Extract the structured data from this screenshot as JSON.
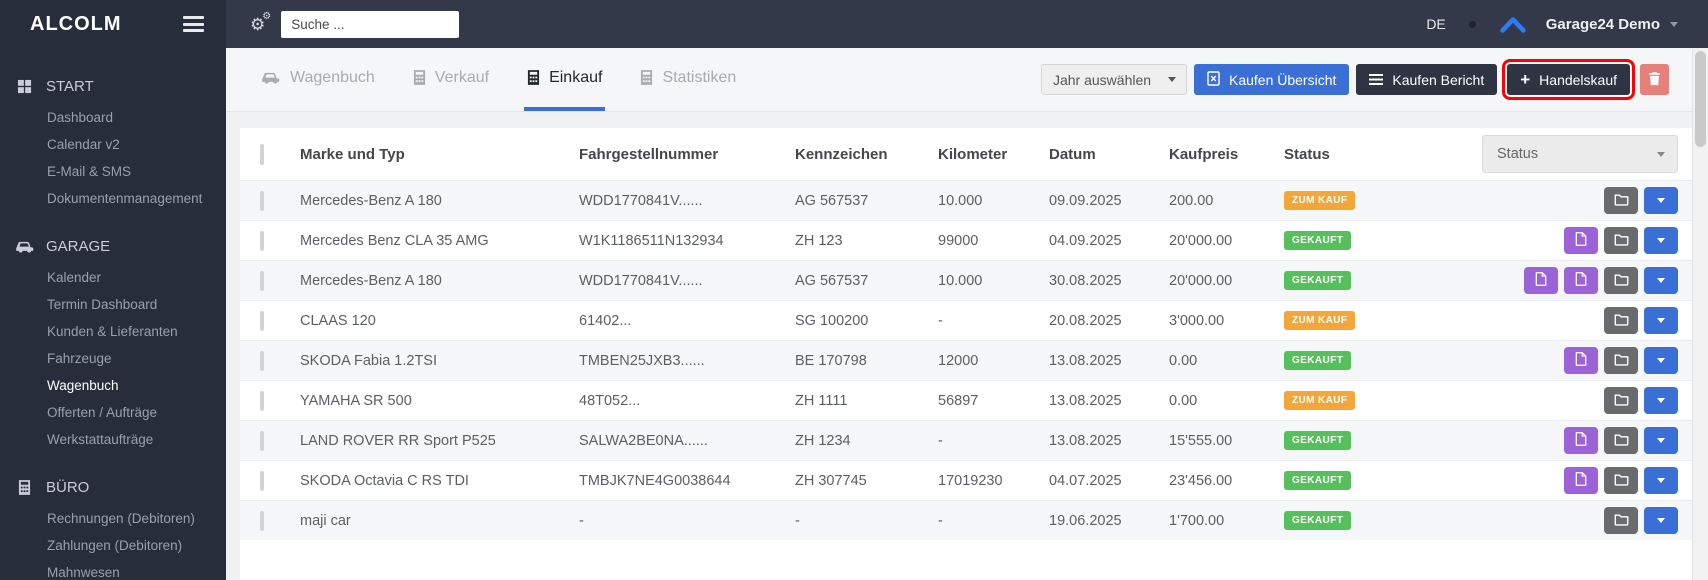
{
  "app": {
    "brand": "ALCOLM"
  },
  "topbar": {
    "search_placeholder": "Suche ...",
    "language": "DE",
    "account_name": "Garage24 Demo"
  },
  "sidebar": {
    "sections": [
      {
        "label": "START",
        "icon": "grid",
        "items": [
          "Dashboard",
          "Calendar v2",
          "E-Mail & SMS",
          "Dokumentenmanagement"
        ]
      },
      {
        "label": "GARAGE",
        "icon": "car",
        "active": "Wagenbuch",
        "items": [
          "Kalender",
          "Termin Dashboard",
          "Kunden & Lieferanten",
          "Fahrzeuge",
          "Wagenbuch",
          "Offerten / Aufträge",
          "Werkstattaufträge"
        ]
      },
      {
        "label": "BÜRO",
        "icon": "calculator",
        "items": [
          "Rechnungen (Debitoren)",
          "Zahlungen (Debitoren)",
          "Mahnwesen"
        ]
      }
    ]
  },
  "tabs": [
    {
      "label": "Wagenbuch",
      "icon": "car",
      "active": false
    },
    {
      "label": "Verkauf",
      "icon": "calculator",
      "active": false
    },
    {
      "label": "Einkauf",
      "icon": "calculator",
      "active": true
    },
    {
      "label": "Statistiken",
      "icon": "calculator",
      "active": false
    }
  ],
  "toolbar": {
    "year_select_label": "Jahr auswählen",
    "buy_overview_label": "Kaufen Übersicht",
    "buy_report_label": "Kaufen Bericht",
    "trade_purchase_label": "Handelskauf"
  },
  "table": {
    "columns": [
      "Marke und Typ",
      "Fahrgestellnummer",
      "Kennzeichen",
      "Kilometer",
      "Datum",
      "Kaufpreis",
      "Status"
    ],
    "status_filter_label": "Status",
    "status_colors": {
      "ZUM KAUF": "#f3a73a",
      "GEKAUFT": "#57bf5b"
    },
    "rows": [
      {
        "make": "Mercedes-Benz A 180",
        "vin": "WDD1770841V......",
        "plate": "AG 567537",
        "km": "10.000",
        "date": "09.09.2025",
        "price": "200.00",
        "status": "ZUM KAUF",
        "actions": [
          "folder",
          "dropdown"
        ]
      },
      {
        "make": "Mercedes Benz CLA 35 AMG",
        "vin": "W1K1186511N132934",
        "plate": "ZH 123",
        "km": "99000",
        "date": "04.09.2025",
        "price": "20'000.00",
        "status": "GEKAUFT",
        "actions": [
          "pdf",
          "folder",
          "dropdown"
        ]
      },
      {
        "make": "Mercedes-Benz A 180",
        "vin": "WDD1770841V......",
        "plate": "AG 567537",
        "km": "10.000",
        "date": "30.08.2025",
        "price": "20'000.00",
        "status": "GEKAUFT",
        "actions": [
          "pdf",
          "pdf",
          "folder",
          "dropdown"
        ]
      },
      {
        "make": "CLAAS 120",
        "vin": "61402...",
        "plate": "SG 100200",
        "km": "-",
        "date": "20.08.2025",
        "price": "3'000.00",
        "status": "ZUM KAUF",
        "actions": [
          "folder",
          "dropdown"
        ]
      },
      {
        "make": "SKODA Fabia 1.2TSI",
        "vin": "TMBEN25JXB3......",
        "plate": "BE 170798",
        "km": "12000",
        "date": "13.08.2025",
        "price": "0.00",
        "status": "GEKAUFT",
        "actions": [
          "pdf",
          "folder",
          "dropdown"
        ]
      },
      {
        "make": "YAMAHA SR 500",
        "vin": "48T052...",
        "plate": "ZH 1111",
        "km": "56897",
        "date": "13.08.2025",
        "price": "0.00",
        "status": "ZUM KAUF",
        "actions": [
          "folder",
          "dropdown"
        ]
      },
      {
        "make": "LAND ROVER RR Sport P525",
        "vin": "SALWA2BE0NA......",
        "plate": "ZH 1234",
        "km": "-",
        "date": "13.08.2025",
        "price": "15'555.00",
        "status": "GEKAUFT",
        "actions": [
          "pdf",
          "folder",
          "dropdown"
        ]
      },
      {
        "make": "SKODA Octavia C RS TDI",
        "vin": "TMBJK7NE4G0038644",
        "plate": "ZH 307745",
        "km": "17019230",
        "date": "04.07.2025",
        "price": "23'456.00",
        "status": "GEKAUFT",
        "actions": [
          "pdf",
          "folder",
          "dropdown"
        ]
      },
      {
        "make": "maji car",
        "vin": "-",
        "plate": "-",
        "km": "-",
        "date": "19.06.2025",
        "price": "1'700.00",
        "status": "GEKAUFT",
        "actions": [
          "folder",
          "dropdown"
        ]
      }
    ]
  },
  "colors": {
    "annotation_red": "#fe0000",
    "accent_blue": "#3a70d6",
    "tab_underline_blue": "#3b6fd6",
    "dark_button": "#2e3442",
    "pdf_purple": "#9c63d8",
    "folder_gray": "#6a6b6c",
    "trash_salmon": "#e6807a",
    "badge_orange": "#f3a73a",
    "badge_green": "#57bf5b",
    "sidebar_bg": "#282d3c",
    "topbar_bg": "#333949"
  }
}
